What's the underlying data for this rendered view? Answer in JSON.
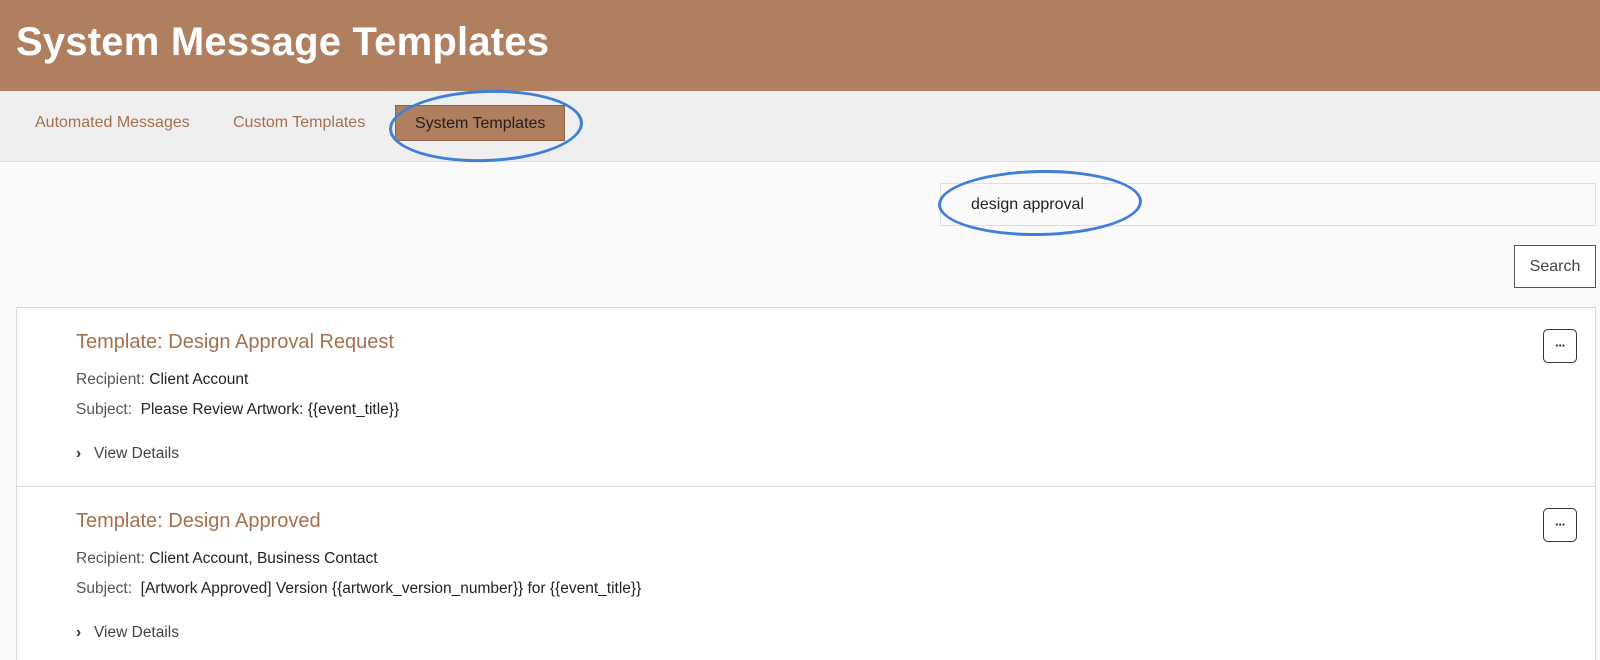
{
  "header": {
    "title": "System Message Templates"
  },
  "tabs": [
    {
      "label": "Automated Messages",
      "active": false
    },
    {
      "label": "Custom Templates",
      "active": false
    },
    {
      "label": "System Templates",
      "active": true
    }
  ],
  "search": {
    "value": "design approval",
    "button_label": "Search"
  },
  "templates": [
    {
      "title": "Template: Design Approval Request",
      "recipient_label": "Recipient:",
      "recipient": "Client Account",
      "subject_label": "Subject:",
      "subject": "Please Review Artwork: {{event_title}}",
      "details_label": "View Details",
      "menu_label": "···"
    },
    {
      "title": "Template: Design Approved",
      "recipient_label": "Recipient:",
      "recipient": "Client Account, Business Contact",
      "subject_label": "Subject:",
      "subject": "[Artwork Approved] Version {{artwork_version_number}} for {{event_title}}",
      "details_label": "View Details",
      "menu_label": "···"
    }
  ],
  "colors": {
    "brand": "#b07f5f",
    "link": "#a4704e",
    "annotation": "#3f7fd8"
  },
  "icons": {
    "details": "chevron-right-icon",
    "menu": "more-horizontal-icon"
  }
}
